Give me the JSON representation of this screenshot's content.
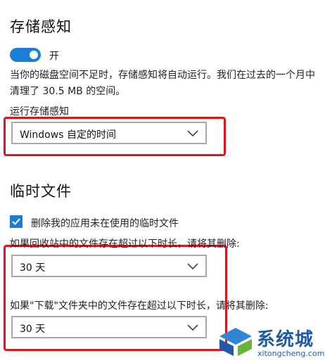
{
  "storage_sense": {
    "title": "存储感知",
    "toggle": {
      "state_label": "开",
      "on": true
    },
    "description": "当你的磁盘空间不足时，存储感知将自动运行。我们在过去的一个月中清理了 30.5 MB 的空间。",
    "run_label": "运行存储感知",
    "run_select": {
      "value": "Windows 自定的时间"
    }
  },
  "temp_files": {
    "title": "临时文件",
    "checkbox": {
      "label": "删除我的应用未在使用的临时文件",
      "checked": true
    },
    "recycle_label": "如果回收站中的文件存在超过以下时长，请将其删除:",
    "recycle_select": {
      "value": "30 天"
    },
    "downloads_label": "如果\"下载\"文件夹中的文件存在超过以下时长，请将其删除:",
    "downloads_select": {
      "value": "30 天"
    }
  },
  "watermark": {
    "brand": "系统城",
    "url": "xitongcheng.com"
  },
  "colors": {
    "accent": "#1a7fd4",
    "highlight": "#e0141a",
    "watermark": "#1f5aa8"
  }
}
